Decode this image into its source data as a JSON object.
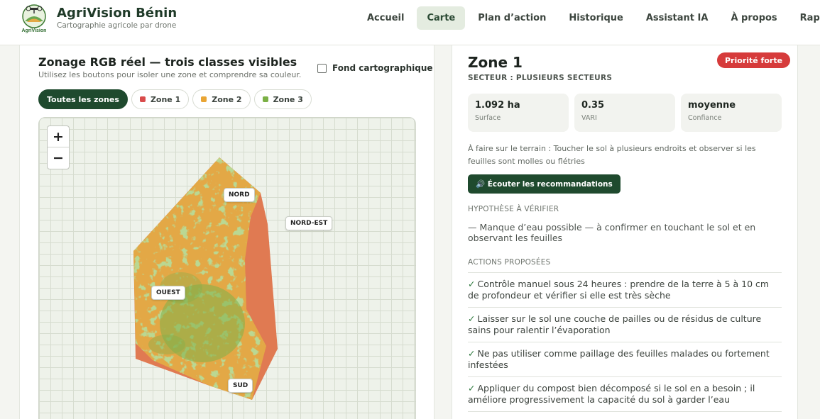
{
  "brand": {
    "name": "AgriVision Bénin",
    "tagline": "Cartographie agricole par drone",
    "logo_text": "AgriVision"
  },
  "nav": {
    "items": [
      {
        "label": "Accueil",
        "active": false
      },
      {
        "label": "Carte",
        "active": true
      },
      {
        "label": "Plan d’action",
        "active": false
      },
      {
        "label": "Historique",
        "active": false
      },
      {
        "label": "Assistant IA",
        "active": false
      },
      {
        "label": "À propos",
        "active": false
      },
      {
        "label": "Rapport",
        "active": false
      }
    ]
  },
  "map_panel": {
    "title": "Zonage RGB réel — trois classes visibles",
    "subtitle": "Utilisez les boutons pour isoler une zone et comprendre sa couleur.",
    "basemap_label": "Fond cartographique",
    "basemap_checked": false,
    "filters": [
      {
        "label": "Toutes les zones",
        "active": true,
        "color": ""
      },
      {
        "label": "Zone 1",
        "active": false,
        "color": "#d94b4b"
      },
      {
        "label": "Zone 2",
        "active": false,
        "color": "#e9a534"
      },
      {
        "label": "Zone 3",
        "active": false,
        "color": "#7bb045"
      }
    ],
    "zoom_in": "+",
    "zoom_out": "−",
    "labels": {
      "nord": "NORD",
      "nord_est": "NORD-EST",
      "ouest": "OUEST",
      "sud": "SUD"
    },
    "zone_colors": {
      "zone1": "#e07a52",
      "zone2": "#e3a846",
      "zone3": "#7fb04a"
    }
  },
  "detail": {
    "title": "Zone 1",
    "sector": "SECTEUR : PLUSIEURS SECTEURS",
    "priority": "Priorité forte",
    "stats": [
      {
        "value": "1.092 ha",
        "label": "Surface"
      },
      {
        "value": "0.35",
        "label": "VARI"
      },
      {
        "value": "moyenne",
        "label": "Confiance"
      }
    ],
    "task": "À faire sur le terrain : Toucher le sol à plusieurs endroits et observer si les feuilles sont molles ou flétries",
    "listen_button": "🔊 Écouter les recommandations",
    "hypothesis_heading": "HYPOTHÈSE À VÉRIFIER",
    "hypothesis": "— Manque d’eau possible — à confirmer en touchant le sol et en observant les feuilles",
    "actions_heading": "ACTIONS PROPOSÉES",
    "actions": [
      "Contrôle manuel sous 24 heures : prendre de la terre à 5 à 10 cm de profondeur et vérifier si elle est très sèche",
      "Laisser sur le sol une couche de pailles ou de résidus de culture sains pour ralentir l’évaporation",
      "Ne pas utiliser comme paillage des feuilles malades ou fortement infestées",
      "Appliquer du compost bien décomposé si le sol en a besoin ; il améliore progressivement la capacité du sol à garder l’eau"
    ],
    "check_mark": "✓",
    "priority_color": "#d63b3b"
  }
}
